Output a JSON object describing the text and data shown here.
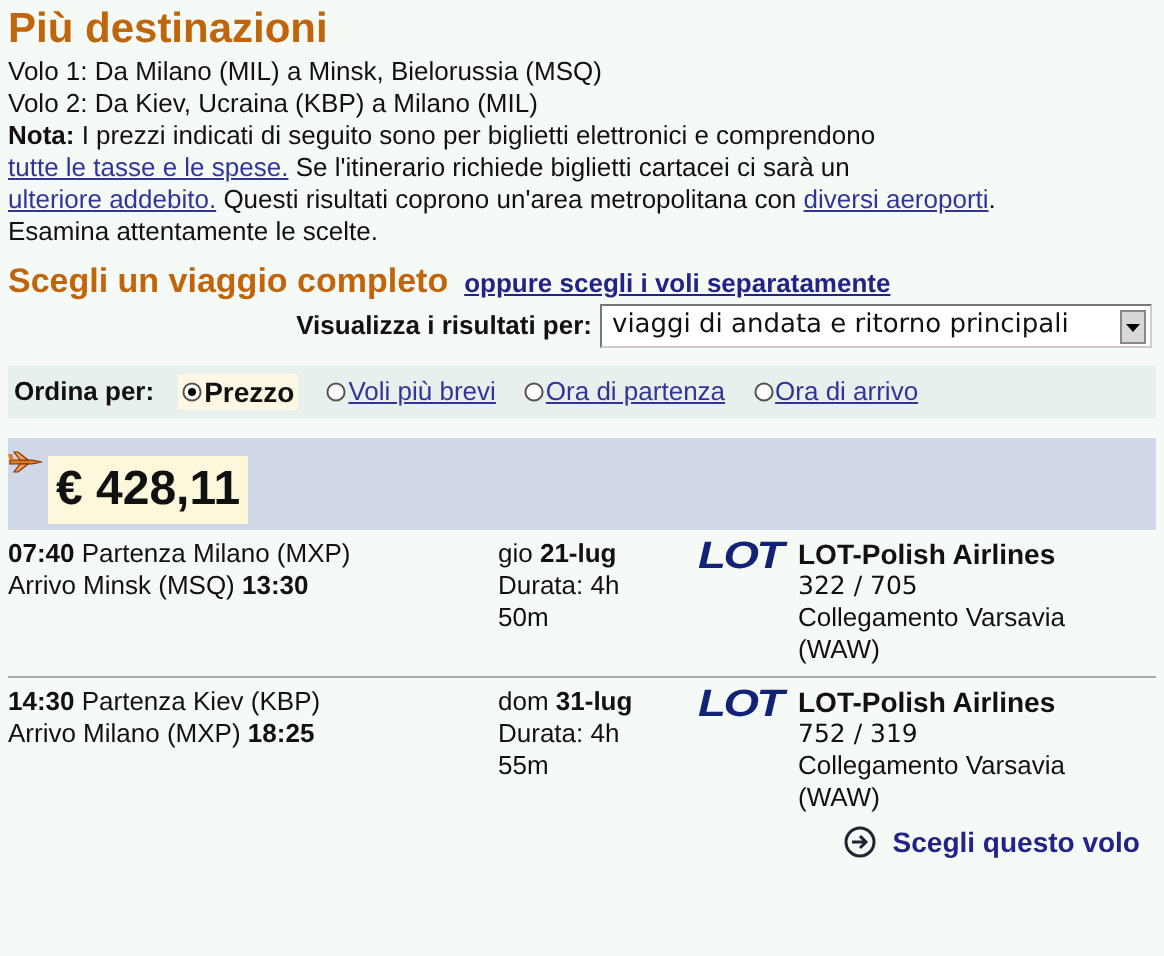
{
  "title": "Più destinazioni",
  "flights": [
    "Volo 1: Da Milano (MIL) a Minsk, Bielorussia (MSQ)",
    "Volo 2: Da Kiev, Ucraina (KBP) a Milano (MIL)"
  ],
  "note": [
    {
      "kind": "bold",
      "text": "Nota:"
    },
    {
      "kind": "text",
      "text": " I prezzi indicati di seguito sono per biglietti elettronici e comprendono "
    },
    {
      "kind": "link",
      "text": "tutte le tasse e le spese."
    },
    {
      "kind": "text",
      "text": " Se l'itinerario richiede biglietti cartacei ci sarà un "
    },
    {
      "kind": "link",
      "text": "ulteriore addebito."
    },
    {
      "kind": "text",
      "text": " Questi risultati coprono un'area metropolitana con "
    },
    {
      "kind": "link",
      "text": "diversi aeroporti"
    },
    {
      "kind": "text",
      "text": ". Esamina attentamente le scelte."
    }
  ],
  "section_title": "Scegli un viaggio completo",
  "alt_link": "oppure scegli i voli separatamente",
  "view": {
    "label": "Visualizza i risultati per:",
    "value": "viaggi di andata e ritorno principali"
  },
  "sort": {
    "label": "Ordina per:",
    "options": [
      {
        "label": "Prezzo",
        "selected": true
      },
      {
        "label": "Voli più brevi",
        "selected": false
      },
      {
        "label": "Ora di partenza",
        "selected": false
      },
      {
        "label": "Ora di arrivo",
        "selected": false
      }
    ]
  },
  "price": "€ 428,11",
  "legs": [
    {
      "depart": "**07:40** Partenza Milano (MXP)",
      "arrive": "Arrivo Minsk (MSQ) **13:30**",
      "date": "gio **21-lug**",
      "duration": "Durata: 4h 50m",
      "logo": "LOT",
      "airline": "LOT-Polish Airlines",
      "numbers": "322  / 705",
      "connection": "Collegamento Varsavia (WAW)"
    },
    {
      "depart": "**14:30** Partenza Kiev (KBP)",
      "arrive": "Arrivo Milano (MXP) **18:25**",
      "date": "dom **31-lug**",
      "duration": "Durata: 4h 55m",
      "logo": "LOT",
      "airline": "LOT-Polish Airlines",
      "numbers": "752  / 319",
      "connection": "Collegamento Varsavia (WAW)"
    }
  ],
  "choose": "Scegli questo volo"
}
